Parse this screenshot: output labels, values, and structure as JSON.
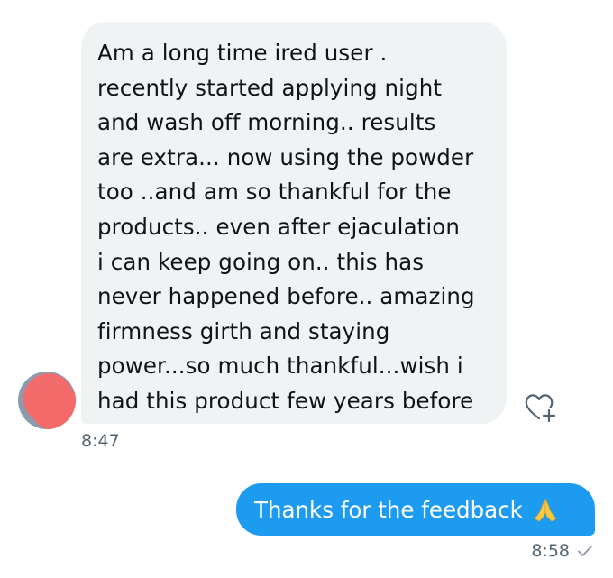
{
  "conversation": {
    "incoming": {
      "lines": [
        "Am a long time ired user .",
        "recently started applying night",
        "and wash off morning.. results",
        "are extra... now using the powder",
        "too ..and am so thankful for the",
        "products.. even after ejaculation",
        "i can keep going on.. this has",
        "never happened before.. amazing",
        "firmness girth and staying",
        "power...so much thankful...wish i",
        "had this product few years before"
      ],
      "time": "8:47",
      "reaction_icon": "heart-plus-icon"
    },
    "outgoing": {
      "text": "Thanks for the feedback",
      "emoji_icon": "folded-hands-icon",
      "time": "8:58",
      "status_icon": "sent-check-icon"
    }
  },
  "colors": {
    "incoming_bubble": "#eff3f4",
    "outgoing_bubble": "#1d9bf0",
    "timestamp": "#536471"
  }
}
